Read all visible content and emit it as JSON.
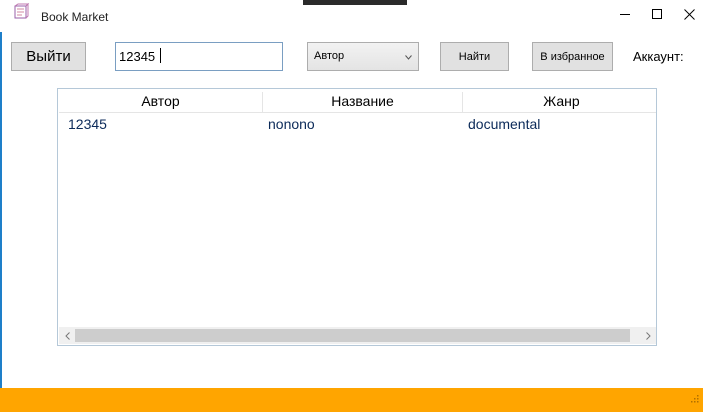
{
  "window": {
    "title": "Book Market",
    "icon": "book-icon",
    "controls": [
      "minimize-icon",
      "maximize-icon",
      "close-icon"
    ]
  },
  "toolbar": {
    "logout_label": "Выйти",
    "search_value": "12345",
    "search_by_selected": "Автор",
    "find_label": "Найти",
    "favorites_label": "В избранное",
    "account_label": "Аккаунт:"
  },
  "table": {
    "columns": [
      "Автор",
      "Название",
      "Жанр"
    ],
    "rows": [
      [
        "12345",
        "nonono",
        "documental"
      ]
    ]
  },
  "colors": {
    "status_bar": "#ffa500",
    "cell_text": "#0b2a59",
    "window_accent": "#1e7fc9"
  }
}
